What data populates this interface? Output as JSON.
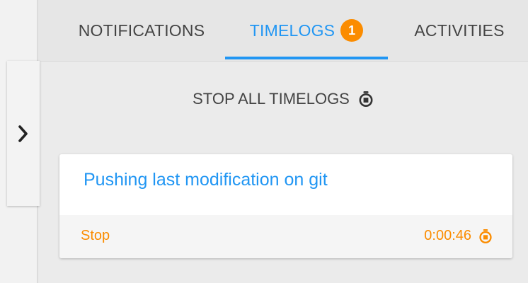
{
  "tabs": {
    "notifications": "NOTIFICATIONS",
    "timelogs": "TIMELOGS",
    "timelogs_badge": "1",
    "activities": "ACTIVITIES",
    "active": "timelogs"
  },
  "sidebar_toggle": {
    "icon": "chevron-right-icon"
  },
  "stop_all": {
    "label": "STOP ALL TIMELOGS",
    "icon": "stopwatch-icon"
  },
  "timelog": {
    "title": "Pushing last modification on git",
    "stop_label": "Stop",
    "elapsed": "0:00:46",
    "icon": "stopwatch-icon"
  },
  "colors": {
    "accent_blue": "#2196f3",
    "accent_orange": "#fb8c00",
    "text_dark": "#444444"
  }
}
